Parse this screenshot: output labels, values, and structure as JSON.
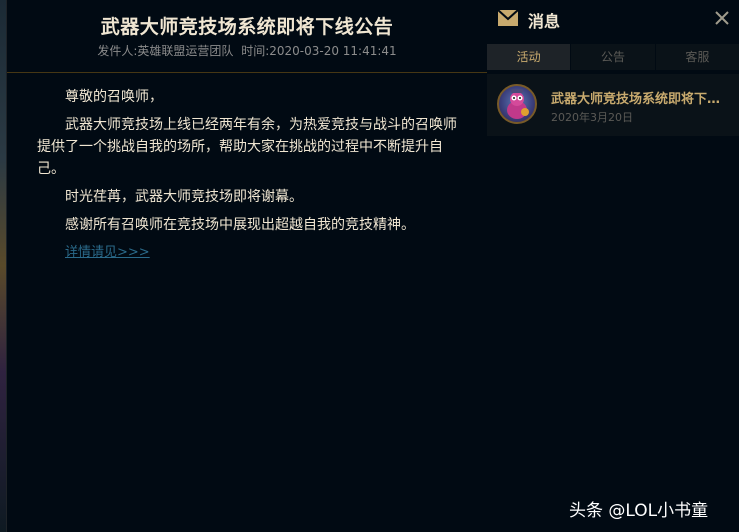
{
  "article": {
    "title": "武器大师竞技场系统即将下线公告",
    "sender": "发件人:英雄联盟运营团队",
    "time": "时间:2020-03-20 11:41:41",
    "paragraphs": [
      "尊敬的召唤师，",
      "武器大师竞技场上线已经两年有余，为热爱竞技与战斗的召唤师提供了一个挑战自我的场所，帮助大家在挑战的过程中不断提升自己。",
      "时光荏苒，武器大师竞技场即将谢幕。",
      "感谢所有召唤师在竞技场中展现出超越自我的竞技精神。"
    ],
    "detail_link": "详情请见>>>"
  },
  "panel": {
    "title": "消息",
    "icon": "mail-icon",
    "close_icon": "close-icon",
    "tabs": [
      {
        "label": "活动",
        "active": true
      },
      {
        "label": "公告",
        "active": false
      },
      {
        "label": "客服",
        "active": false
      }
    ],
    "messages": [
      {
        "title": "武器大师竞技场系统即将下线公告",
        "date": "2020年3月20日"
      }
    ]
  },
  "watermark": "头条 @LOL小书童",
  "colors": {
    "background": "#010a13",
    "gold": "#c8aa6e",
    "text": "#f0e6d2",
    "link": "#2a6a8a"
  }
}
